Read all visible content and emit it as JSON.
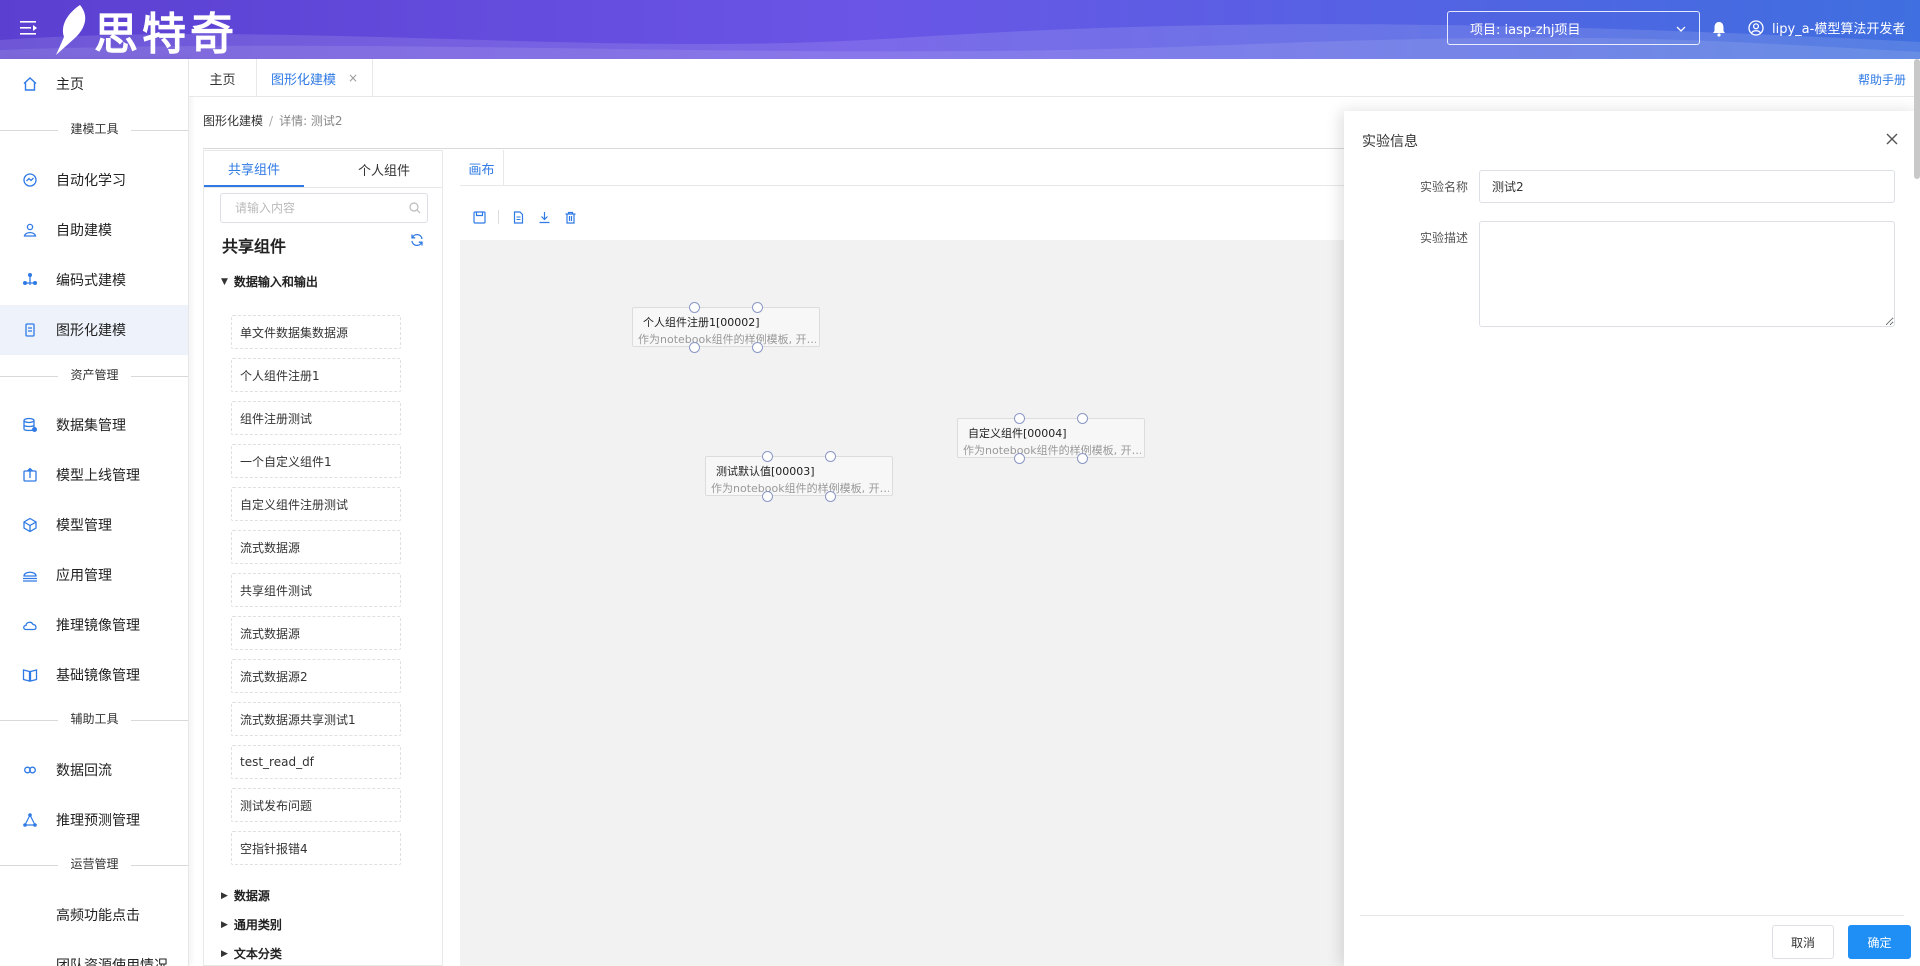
{
  "header": {
    "logo_text": "思特奇",
    "project_label": "项目: iasp-zhj项目",
    "user_label": "lipy_a-模型算法开发者"
  },
  "sidebar": {
    "home": "主页",
    "sections": [
      "建模工具",
      "资产管理",
      "辅助工具",
      "运营管理"
    ],
    "modeling": [
      "自动化学习",
      "自助建模",
      "编码式建模",
      "图形化建模"
    ],
    "assets": [
      "数据集管理",
      "模型上线管理",
      "模型管理",
      "应用管理",
      "推理镜像管理",
      "基础镜像管理"
    ],
    "aux": [
      "数据回流",
      "推理预测管理"
    ],
    "ops": [
      "高频功能点击",
      "团队资源使用情况"
    ],
    "active_item": "图形化建模"
  },
  "tabs": {
    "items": [
      {
        "label": "主页",
        "active": false
      },
      {
        "label": "图形化建模",
        "active": true,
        "close": "×"
      }
    ],
    "help": "帮助手册"
  },
  "breadcrumb": {
    "root": "图形化建模",
    "sep": "/",
    "current": "详情: 测试2"
  },
  "component_panel": {
    "tabs": [
      "共享组件",
      "个人组件"
    ],
    "search_placeholder": "请输入内容",
    "title": "共享组件",
    "groups": [
      "数据输入和输出",
      "数据源",
      "通用类别",
      "文本分类"
    ],
    "items": [
      "单文件数据集数据源",
      "个人组件注册1",
      "组件注册测试",
      "一个自定义组件1",
      "自定义组件注册测试",
      "流式数据源",
      "共享组件测试",
      "流式数据源",
      "流式数据源2",
      "流式数据源共享测试1",
      "test_read_df",
      "测试发布问题",
      "空指针报错4"
    ]
  },
  "canvas": {
    "tab": "画布",
    "nodes": [
      {
        "title": "个人组件注册1[00002]",
        "desc": "作为notebook组件的样例模板, 开…"
      },
      {
        "title": "测试默认值[00003]",
        "desc": "作为notebook组件的样例模板, 开…"
      },
      {
        "title": "自定义组件[00004]",
        "desc": "作为notebook组件的样例模板, 开…"
      }
    ]
  },
  "drawer": {
    "title": "实验信息",
    "name_label": "实验名称",
    "name_value": "测试2",
    "desc_label": "实验描述",
    "desc_value": "",
    "cancel": "取消",
    "confirm": "确定"
  },
  "colors": {
    "accent": "#2f7ae5",
    "primary_button": "#1f8ff5",
    "header_start": "#5b3fd1",
    "header_end": "#3f6fe0"
  }
}
